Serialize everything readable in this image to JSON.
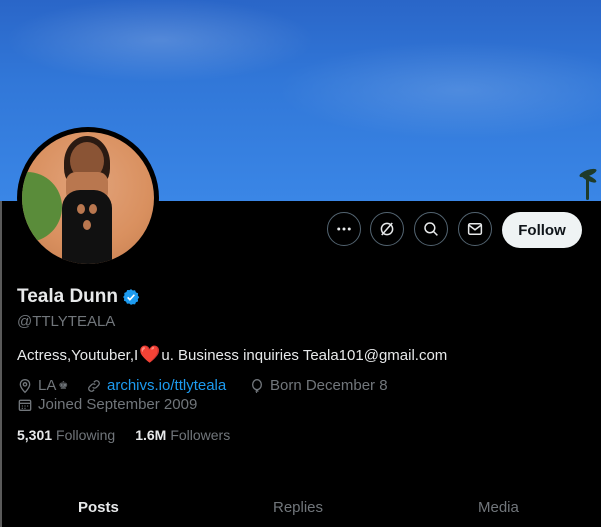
{
  "profile": {
    "display_name": "Teala Dunn",
    "handle": "@TTLYTEALA",
    "bio_prefix": "Actress,Youtuber,I",
    "bio_heart": "❤️",
    "bio_suffix": "u. Business inquiries Teala101@gmail.com",
    "location": "LA",
    "location_badge": "♚",
    "website": "archivs.io/ttlyteala",
    "birthday": "Born December 8",
    "joined": "Joined September 2009",
    "following_count": "5,301",
    "following_label": "Following",
    "followers_count": "1.6M",
    "followers_label": "Followers"
  },
  "actions": {
    "more_icon": "more-icon",
    "grok_icon": "grok-icon",
    "search_icon": "search-icon",
    "message_icon": "message-icon",
    "follow_label": "Follow"
  },
  "tabs": [
    {
      "label": "Posts",
      "active": true
    },
    {
      "label": "Replies",
      "active": false
    },
    {
      "label": "Media",
      "active": false
    }
  ],
  "colors": {
    "background": "#000000",
    "accent": "#1d9bf0",
    "secondary_text": "#71767b",
    "banner": "#3177d8",
    "heart": "#e0245e"
  }
}
